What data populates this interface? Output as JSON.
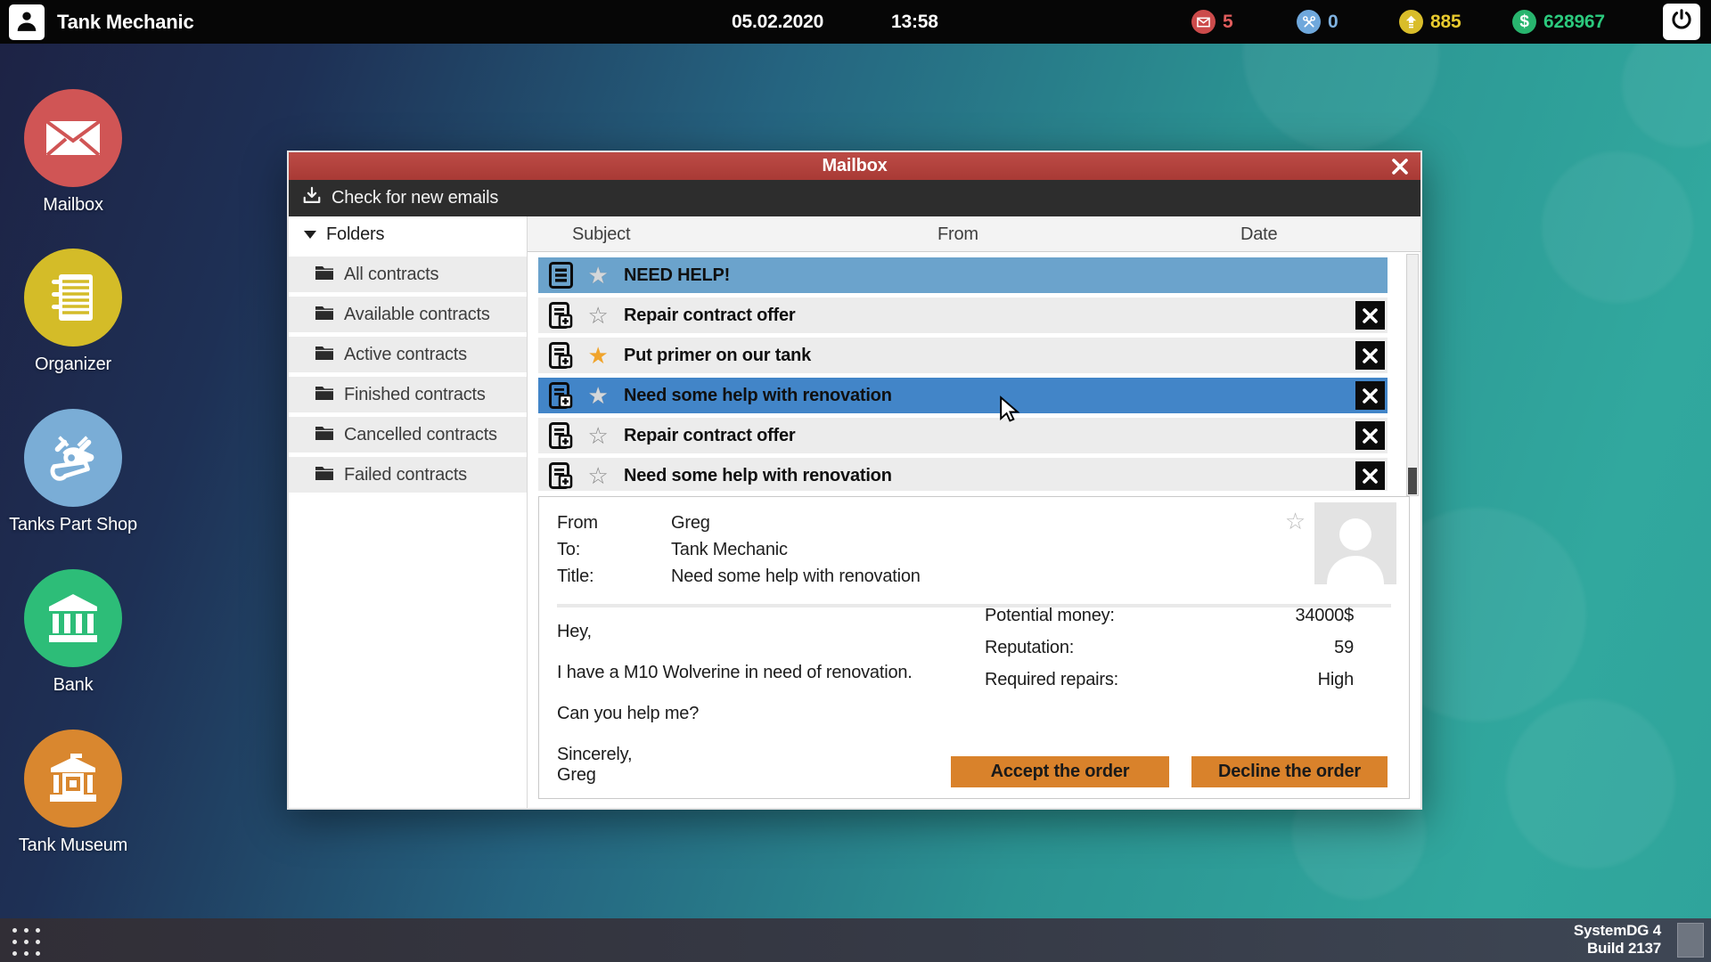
{
  "topbar": {
    "app_title": "Tank Mechanic",
    "date": "05.02.2020",
    "time": "13:58",
    "stats": {
      "messages": "5",
      "repairs": "0",
      "experience": "885",
      "money": "628967"
    }
  },
  "desktop": {
    "icons": [
      {
        "label": "Mailbox",
        "icon": "envelope-icon",
        "color": "#d05555"
      },
      {
        "label": "Organizer",
        "icon": "notebook-icon",
        "color": "#d4bc28"
      },
      {
        "label": "Tanks Part Shop",
        "icon": "tools-icon",
        "color": "#7aadd6"
      },
      {
        "label": "Bank",
        "icon": "bank-icon",
        "color": "#2dbd78"
      },
      {
        "label": "Tank Museum",
        "icon": "museum-icon",
        "color": "#d9872f"
      }
    ]
  },
  "window": {
    "title": "Mailbox",
    "toolbar": {
      "check_label": "Check for new emails"
    },
    "folders": {
      "header": "Folders",
      "items": [
        "All contracts",
        "Available contracts",
        "Active contracts",
        "Finished contracts",
        "Cancelled contracts",
        "Failed contracts"
      ]
    },
    "list": {
      "columns": {
        "subject": "Subject",
        "from": "From",
        "date": "Date"
      },
      "rows": [
        {
          "subject": "NEED HELP!",
          "icon": "document-icon",
          "star": "silver",
          "selected": "light",
          "deletable": false
        },
        {
          "subject": "Repair contract offer",
          "icon": "contract-add-icon",
          "star": "outline",
          "selected": false,
          "deletable": true
        },
        {
          "subject": "Put primer on our tank",
          "icon": "contract-add-icon",
          "star": "gold",
          "selected": false,
          "deletable": true
        },
        {
          "subject": "Need some help with renovation",
          "icon": "contract-add-icon",
          "star": "silver",
          "selected": "strong",
          "deletable": true
        },
        {
          "subject": "Repair contract offer",
          "icon": "contract-add-icon",
          "star": "outline",
          "selected": false,
          "deletable": true
        },
        {
          "subject": "Need some help with renovation",
          "icon": "contract-add-icon",
          "star": "outline",
          "selected": false,
          "deletable": true
        }
      ]
    },
    "reader": {
      "from_label": "From",
      "from": "Greg",
      "to_label": "To:",
      "to": "Tank Mechanic",
      "title_label": "Title:",
      "title": "Need some help with renovation",
      "body": [
        "Hey,",
        "I have a M10 Wolverine in need of renovation.",
        "Can you help me?",
        "Sincerely,",
        "Greg"
      ],
      "details": [
        {
          "label": "Potential money:",
          "value": "34000$"
        },
        {
          "label": "Reputation:",
          "value": "59"
        },
        {
          "label": "Required repairs:",
          "value": "High"
        }
      ],
      "accept_label": "Accept the order",
      "decline_label": "Decline the order"
    }
  },
  "taskbar": {
    "system_line1": "SystemDG 4",
    "system_line2": "Build 2137"
  },
  "colors": {
    "titlebar_red": "#b5423e",
    "selected_row_light": "#6ba3cc",
    "selected_row_strong": "#4285c8",
    "order_button_orange": "#d9822b",
    "star_gold": "#f0a42c",
    "mail_red": "#cc4b4b",
    "wrench_blue": "#6fa8dc",
    "xp_yellow": "#d9bd2a",
    "money_green": "#28b56e"
  }
}
